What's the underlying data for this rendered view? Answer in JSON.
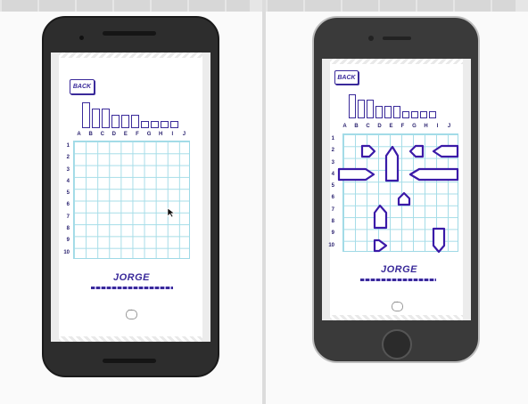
{
  "left_device": {
    "back_label": "BACK",
    "columns": [
      "A",
      "B",
      "C",
      "D",
      "E",
      "F",
      "G",
      "H",
      "I",
      "J"
    ],
    "rows": [
      "1",
      "2",
      "3",
      "4",
      "5",
      "6",
      "7",
      "8",
      "9",
      "10"
    ],
    "player_name": "JORGE",
    "chat_icon": "chat-bubble-icon",
    "cursor_icon": "mouse-pointer-icon"
  },
  "right_device": {
    "back_label": "BACK",
    "columns": [
      "A",
      "B",
      "C",
      "D",
      "E",
      "F",
      "G",
      "H",
      "I",
      "J"
    ],
    "rows": [
      "1",
      "2",
      "3",
      "4",
      "5",
      "6",
      "7",
      "8",
      "9",
      "10"
    ],
    "player_name": "JORGE",
    "chat_icon": "chat-bubble-icon"
  },
  "colors": {
    "ink": "#3a2a9a",
    "grid": "#a6dde8",
    "label": "#2b2370"
  }
}
